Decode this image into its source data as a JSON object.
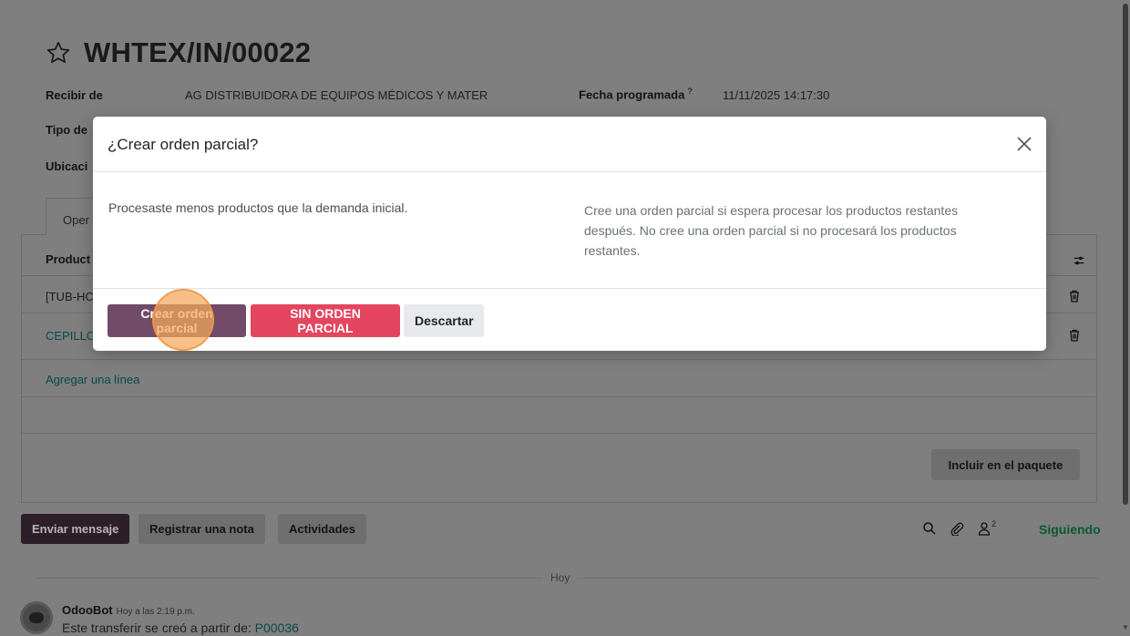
{
  "record": {
    "title": "WHTEX/IN/00022",
    "receive_from_label": "Recibir de",
    "receive_from_value": "AG DISTRIBUIDORA DE EQUIPOS MÉDICOS Y MATER",
    "scheduled_date_label": "Fecha programada",
    "scheduled_date_hint": "?",
    "scheduled_date_value": "11/11/2025 14:17:30",
    "operation_type_label_partial": "Tipo de",
    "location_label_partial": "Ubicaci",
    "tab_partial": "Oper",
    "column_product_partial": "Product",
    "row1_partial": "[TUB-HC",
    "row2_partial": "CEPILLC",
    "add_line": "Agregar una línea",
    "include_package_button": "Incluir en el paquete"
  },
  "chatter": {
    "send_message": "Enviar mensaje",
    "log_note": "Registrar una nota",
    "activities": "Actividades",
    "follower_count": "2",
    "following": "Siguiendo",
    "day_separator": "Hoy",
    "author": "OdooBot",
    "time": "Hoy a las 2:19 p.m.",
    "message_prefix": "Este transferir se creó a partir de: ",
    "message_link": "P00036"
  },
  "modal": {
    "title": "¿Crear orden parcial?",
    "left_text": "Procesaste menos productos que la demanda inicial.",
    "right_text": "Cree una orden parcial si espera procesar los productos restantes después. No cree una orden parcial si no procesará los productos restantes.",
    "primary_button": "Crear orden parcial",
    "danger_button": "SIN ORDEN PARCIAL",
    "secondary_button": "Descartar"
  },
  "colors": {
    "primary": "#714b67",
    "danger": "#e4455f",
    "secondary": "#e7e9ed",
    "link": "#017e84",
    "click_highlight": "#f5a65a"
  },
  "icons": {
    "star": "star-icon",
    "close": "close-icon",
    "trash": "trash-icon",
    "settings": "sliders-icon",
    "search": "search-icon",
    "attachment": "paperclip-icon",
    "followers": "user-icon"
  }
}
